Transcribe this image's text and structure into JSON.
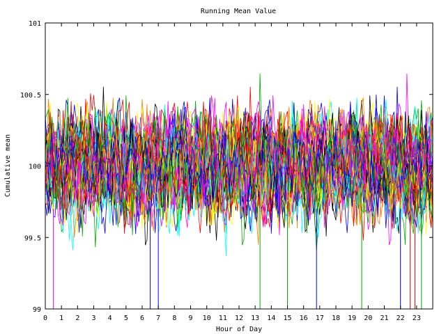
{
  "chart_data": {
    "type": "line",
    "title": "Running Mean Value",
    "xlabel": "Hour of Day",
    "ylabel": "Cumulative mean",
    "xlim": [
      0,
      24
    ],
    "ylim": [
      99,
      101
    ],
    "x_ticks": [
      "0",
      "1",
      "2",
      "3",
      "4",
      "5",
      "6",
      "7",
      "8",
      "9",
      "10",
      "11",
      "12",
      "13",
      "14",
      "15",
      "16",
      "17",
      "18",
      "19",
      "20",
      "21",
      "22",
      "23"
    ],
    "y_ticks": [
      "99",
      "99.5",
      "100",
      "100.5",
      "101"
    ],
    "grid": false,
    "legend": "none",
    "series_colors": [
      "#ff0000",
      "#00aa00",
      "#0000ff",
      "#ff00ff",
      "#00ffff",
      "#ffff00",
      "#000000",
      "#ff8000"
    ],
    "series_count": 60,
    "samples_per_series": 240,
    "value_center": 100,
    "value_typical_range": [
      99.6,
      100.45
    ],
    "value_extremes": [
      99.2,
      100.82
    ],
    "note_spikes_to_99_at_hours": [
      0.5,
      6.5,
      7.0,
      13.3,
      15.0,
      16.8,
      19.6,
      22.0,
      22.6,
      22.9,
      23.3
    ]
  }
}
